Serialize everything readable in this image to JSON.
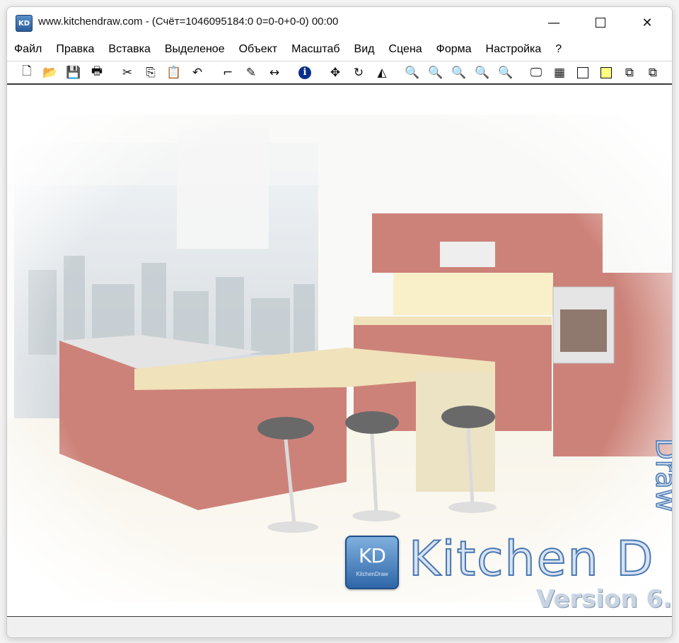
{
  "window": {
    "title": "www.kitchendraw.com - (Счёт=1046095184:0 0=0-0+0-0) 00:00",
    "app_icon_label": "KD",
    "minimize_glyph": "—",
    "close_glyph": "✕"
  },
  "menu": {
    "items": [
      "Файл",
      "Правка",
      "Вставка",
      "Выделеное",
      "Объект",
      "Масштаб",
      "Вид",
      "Сцена",
      "Форма",
      "Настройка",
      "?"
    ]
  },
  "toolbar": {
    "icons": [
      {
        "name": "new-file-icon",
        "glyph": "🗋"
      },
      {
        "name": "open-folder-icon",
        "glyph": "📂"
      },
      {
        "name": "save-icon",
        "glyph": "💾"
      },
      {
        "name": "print-icon",
        "glyph": "🖶"
      },
      {
        "name": "cut-icon",
        "glyph": "✂"
      },
      {
        "name": "copy-icon",
        "glyph": "⎘"
      },
      {
        "name": "paste-icon",
        "glyph": "📋"
      },
      {
        "name": "undo-icon",
        "glyph": "↶"
      },
      {
        "name": "stairs-icon",
        "glyph": "⌐"
      },
      {
        "name": "paint-icon",
        "glyph": "✎"
      },
      {
        "name": "dimension-icon",
        "glyph": "↔"
      },
      {
        "name": "info-icon",
        "glyph": "i"
      },
      {
        "name": "move-icon",
        "glyph": "✥"
      },
      {
        "name": "rotate-icon",
        "glyph": "↻"
      },
      {
        "name": "mirror-icon",
        "glyph": "◭"
      },
      {
        "name": "zoom-in-icon",
        "glyph": "🔍"
      },
      {
        "name": "zoom-out-icon",
        "glyph": "🔍"
      },
      {
        "name": "zoom-window-icon",
        "glyph": "🔍"
      },
      {
        "name": "zoom-fit-icon",
        "glyph": "🔍"
      },
      {
        "name": "zoom-previous-icon",
        "glyph": "🔍"
      },
      {
        "name": "monitor-icon",
        "glyph": "🖵"
      },
      {
        "name": "grid-view-icon",
        "glyph": "▦"
      },
      {
        "name": "wireframe-box-icon",
        "glyph": ""
      },
      {
        "name": "yellow-box-icon",
        "glyph": ""
      },
      {
        "name": "cube-icon",
        "glyph": "⧉"
      },
      {
        "name": "cube-outline-icon",
        "glyph": "⧉"
      }
    ]
  },
  "splash": {
    "logo_mark": "KD",
    "logo_small_text": "KitchenDraw",
    "brand_name": "Kitchen D",
    "version": "Version 6.",
    "vertical_text": "Draw",
    "colors": {
      "cabinet_red": "#b5483a",
      "countertop": "#e9d59a",
      "stool_seat": "#222222",
      "brand_blue": "#4a79b3"
    }
  }
}
